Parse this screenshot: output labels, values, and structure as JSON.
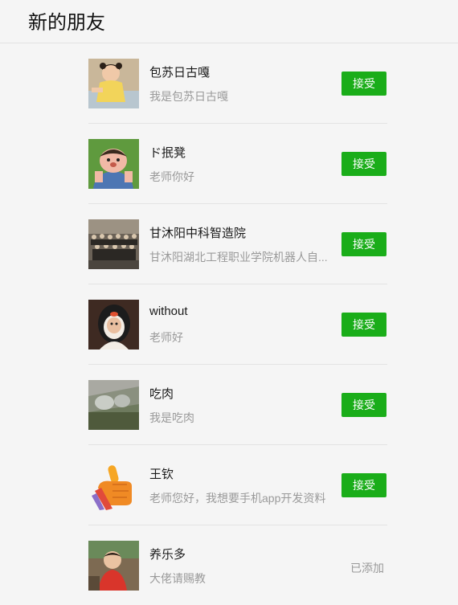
{
  "header": {
    "title": "新的朋友"
  },
  "requests": [
    {
      "name": "包苏日古嘎",
      "message": "我是包苏日古嘎",
      "action": "接受"
    },
    {
      "name": "ド抿凳",
      "message": "老师你好",
      "action": "接受"
    },
    {
      "name": "甘沐阳中科智造院",
      "message": "甘沐阳湖北工程职业学院机器人自...",
      "action": "接受"
    },
    {
      "name": "without",
      "message": "老师好",
      "action": "接受"
    },
    {
      "name": "吃肉",
      "message": "我是吃肉",
      "action": "接受"
    },
    {
      "name": "王钦",
      "message": "老师您好，我想要手机app开发资料",
      "action": "接受"
    },
    {
      "name": "养乐多",
      "message": "大佬请赐教",
      "status": "已添加"
    }
  ],
  "colors": {
    "accept_button": "#1aad19",
    "background": "#f5f5f5"
  }
}
